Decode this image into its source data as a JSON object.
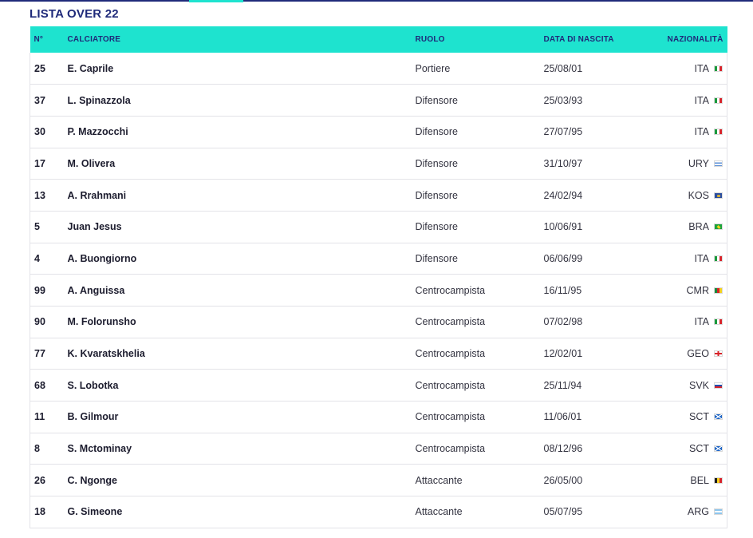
{
  "section": {
    "title": "LISTA OVER 22"
  },
  "table": {
    "headers": {
      "number": "N°",
      "player": "CALCIATORE",
      "role": "RUOLO",
      "dob": "DATA DI NASCITA",
      "nationality": "NAZIONALITÀ"
    },
    "rows": [
      {
        "number": "25",
        "player": "E. Caprile",
        "role": "Portiere",
        "dob": "25/08/01",
        "nationality": "ITA",
        "flag": "italy-flag-icon"
      },
      {
        "number": "37",
        "player": "L. Spinazzola",
        "role": "Difensore",
        "dob": "25/03/93",
        "nationality": "ITA",
        "flag": "italy-flag-icon"
      },
      {
        "number": "30",
        "player": "P. Mazzocchi",
        "role": "Difensore",
        "dob": "27/07/95",
        "nationality": "ITA",
        "flag": "italy-flag-icon"
      },
      {
        "number": "17",
        "player": "M. Olivera",
        "role": "Difensore",
        "dob": "31/10/97",
        "nationality": "URY",
        "flag": "uruguay-flag-icon"
      },
      {
        "number": "13",
        "player": "A. Rrahmani",
        "role": "Difensore",
        "dob": "24/02/94",
        "nationality": "KOS",
        "flag": "kosovo-flag-icon"
      },
      {
        "number": "5",
        "player": "Juan Jesus",
        "role": "Difensore",
        "dob": "10/06/91",
        "nationality": "BRA",
        "flag": "brazil-flag-icon"
      },
      {
        "number": "4",
        "player": "A. Buongiorno",
        "role": "Difensore",
        "dob": "06/06/99",
        "nationality": "ITA",
        "flag": "italy-flag-icon"
      },
      {
        "number": "99",
        "player": "A. Anguissa",
        "role": "Centrocampista",
        "dob": "16/11/95",
        "nationality": "CMR",
        "flag": "cameroon-flag-icon"
      },
      {
        "number": "90",
        "player": "M. Folorunsho",
        "role": "Centrocampista",
        "dob": "07/02/98",
        "nationality": "ITA",
        "flag": "italy-flag-icon"
      },
      {
        "number": "77",
        "player": "K. Kvaratskhelia",
        "role": "Centrocampista",
        "dob": "12/02/01",
        "nationality": "GEO",
        "flag": "georgia-flag-icon"
      },
      {
        "number": "68",
        "player": "S. Lobotka",
        "role": "Centrocampista",
        "dob": "25/11/94",
        "nationality": "SVK",
        "flag": "slovakia-flag-icon"
      },
      {
        "number": "11",
        "player": "B. Gilmour",
        "role": "Centrocampista",
        "dob": "11/06/01",
        "nationality": "SCT",
        "flag": "scotland-flag-icon"
      },
      {
        "number": "8",
        "player": "S. Mctominay",
        "role": "Centrocampista",
        "dob": "08/12/96",
        "nationality": "SCT",
        "flag": "scotland-flag-icon"
      },
      {
        "number": "26",
        "player": "C. Ngonge",
        "role": "Attaccante",
        "dob": "26/05/00",
        "nationality": "BEL",
        "flag": "belgium-flag-icon"
      },
      {
        "number": "18",
        "player": "G. Simeone",
        "role": "Attaccante",
        "dob": "05/07/95",
        "nationality": "ARG",
        "flag": "argentina-flag-icon"
      }
    ]
  },
  "colors": {
    "header_bg": "#1ee3cf",
    "title": "#1f2a7a",
    "row_border": "#e3e3e8"
  }
}
